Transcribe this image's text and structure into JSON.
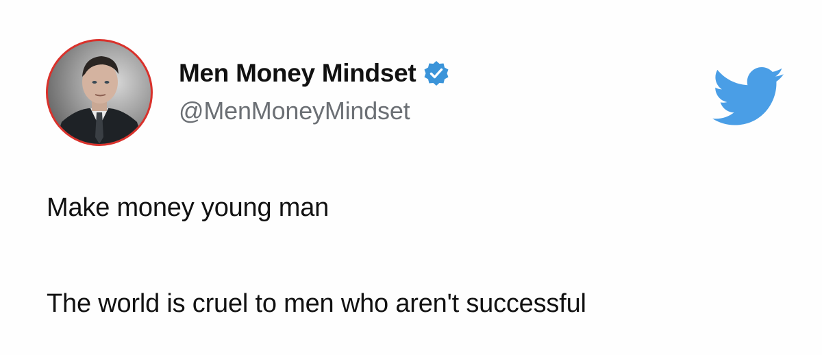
{
  "author": {
    "display_name": "Men Money Mindset",
    "handle": "@MenMoneyMindset",
    "verified": true,
    "avatar_icon": "profile-photo",
    "avatar_ring_color": "#d9312b"
  },
  "brand": {
    "icon": "twitter-bird-icon",
    "color": "#4a9ee6"
  },
  "tweet": {
    "lines": [
      "Make money young man",
      "The world is cruel to men who aren't successful"
    ]
  },
  "colors": {
    "verified_badge": "#3b94d9",
    "handle_text": "#6b6f74",
    "body_text": "#111111"
  }
}
